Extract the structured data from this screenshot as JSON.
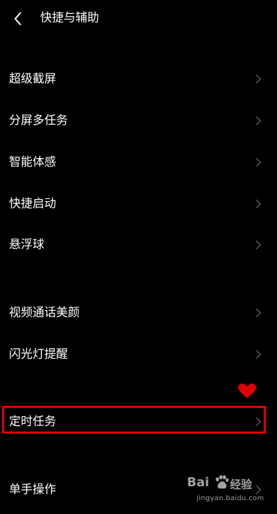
{
  "header": {
    "title": "快捷与辅助",
    "back_icon": "chevron-left-icon"
  },
  "items": [
    {
      "label": "超级截屏"
    },
    {
      "label": "分屏多任务"
    },
    {
      "label": "智能体感"
    },
    {
      "label": "快捷启动"
    },
    {
      "label": "悬浮球"
    },
    {
      "label": "视频通话美颜"
    },
    {
      "label": "闪光灯提醒"
    },
    {
      "label": "定时任务",
      "highlighted": true
    },
    {
      "label": "单手操作"
    }
  ],
  "annotation": {
    "box_color": "#e00000",
    "heart_color": "#e00000"
  },
  "watermark": {
    "logo_prefix": "Bai",
    "logo_suffix": "经验",
    "url": "jingyan.baidu.com"
  },
  "colors": {
    "background": "#000000",
    "text": "#ffffff",
    "chevron": "#5a5a5a"
  }
}
